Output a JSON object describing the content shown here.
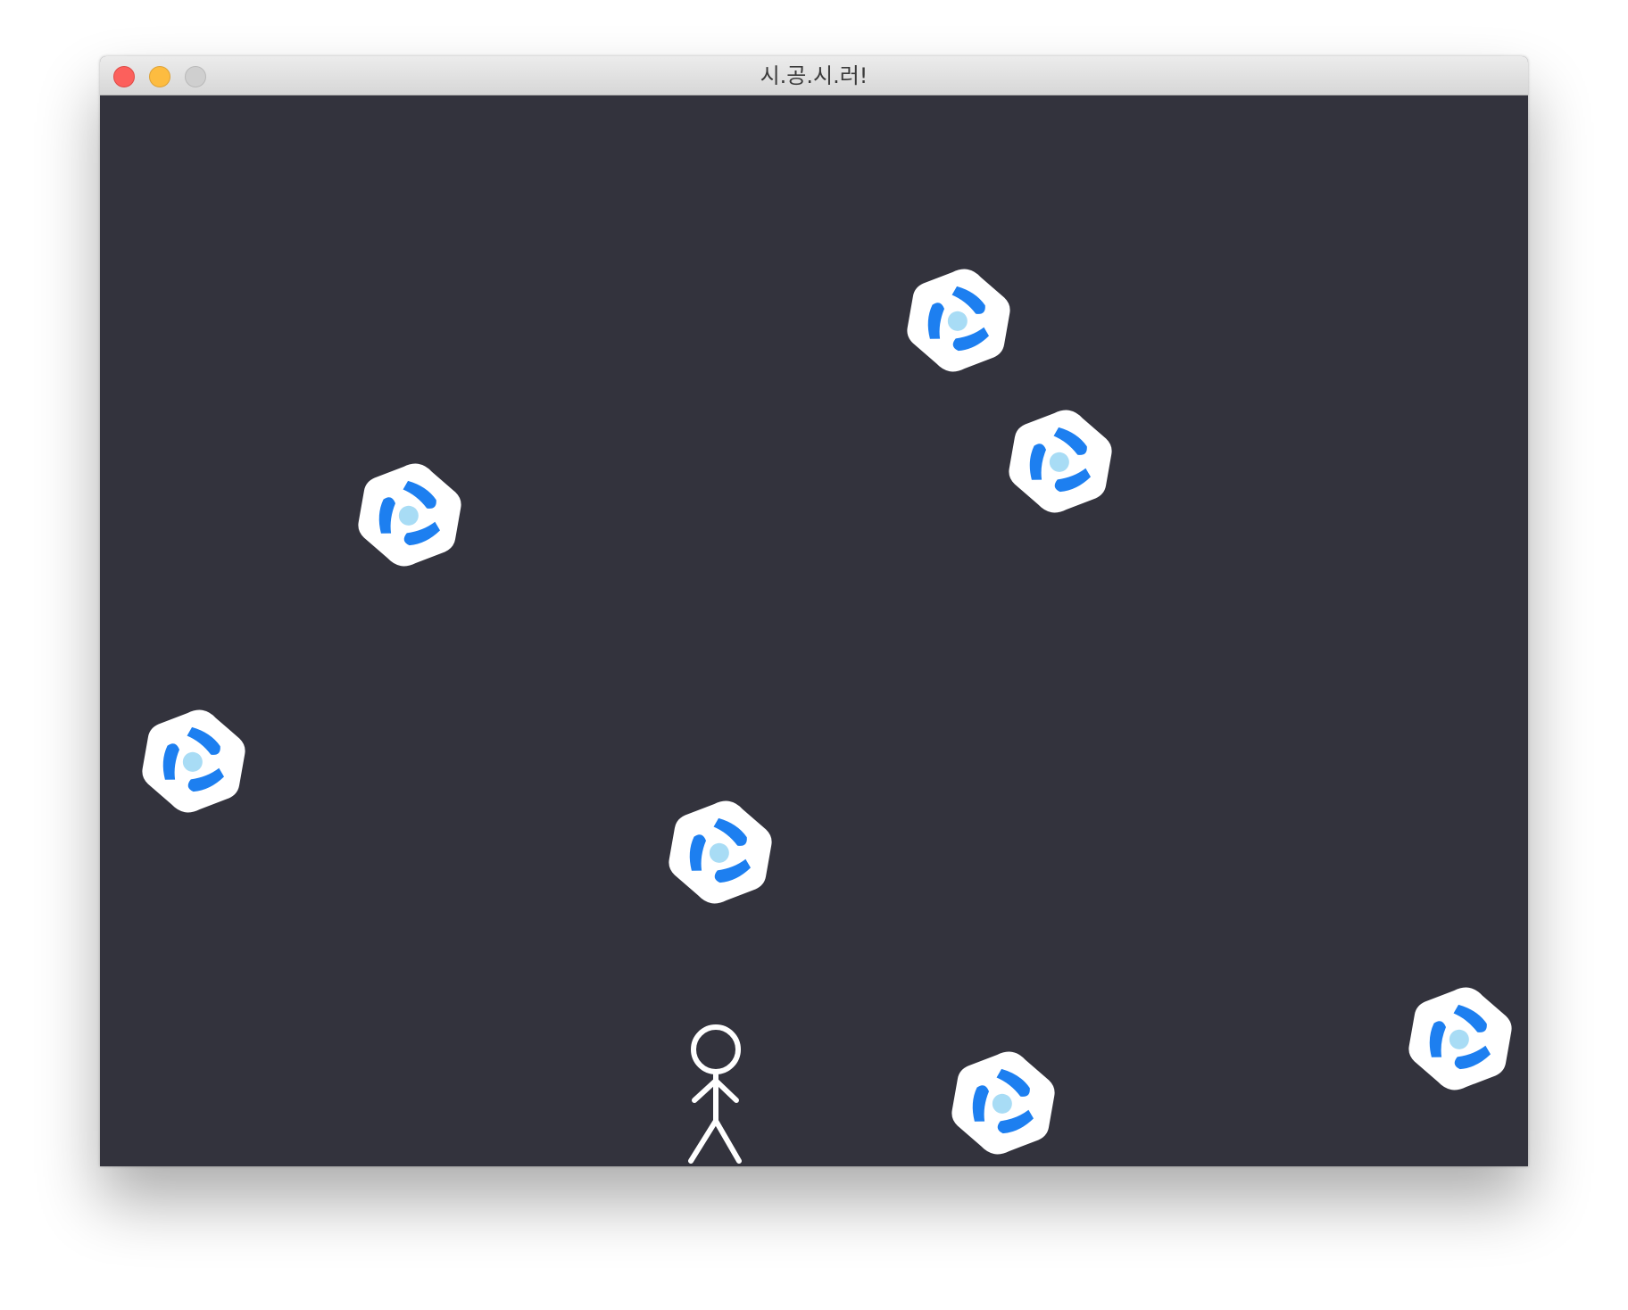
{
  "window": {
    "title": "시.공.시.러!",
    "controls": [
      "close-button",
      "minimize-button",
      "zoom-button"
    ]
  },
  "game": {
    "background_color": "#33333d",
    "sprite_color_primary": "#1d7ff0",
    "sprite_color_core": "#a8dcf5",
    "player_color": "#ffffff",
    "sprites": [
      "protoss-emblem-icon",
      "stick-figure-player"
    ]
  }
}
